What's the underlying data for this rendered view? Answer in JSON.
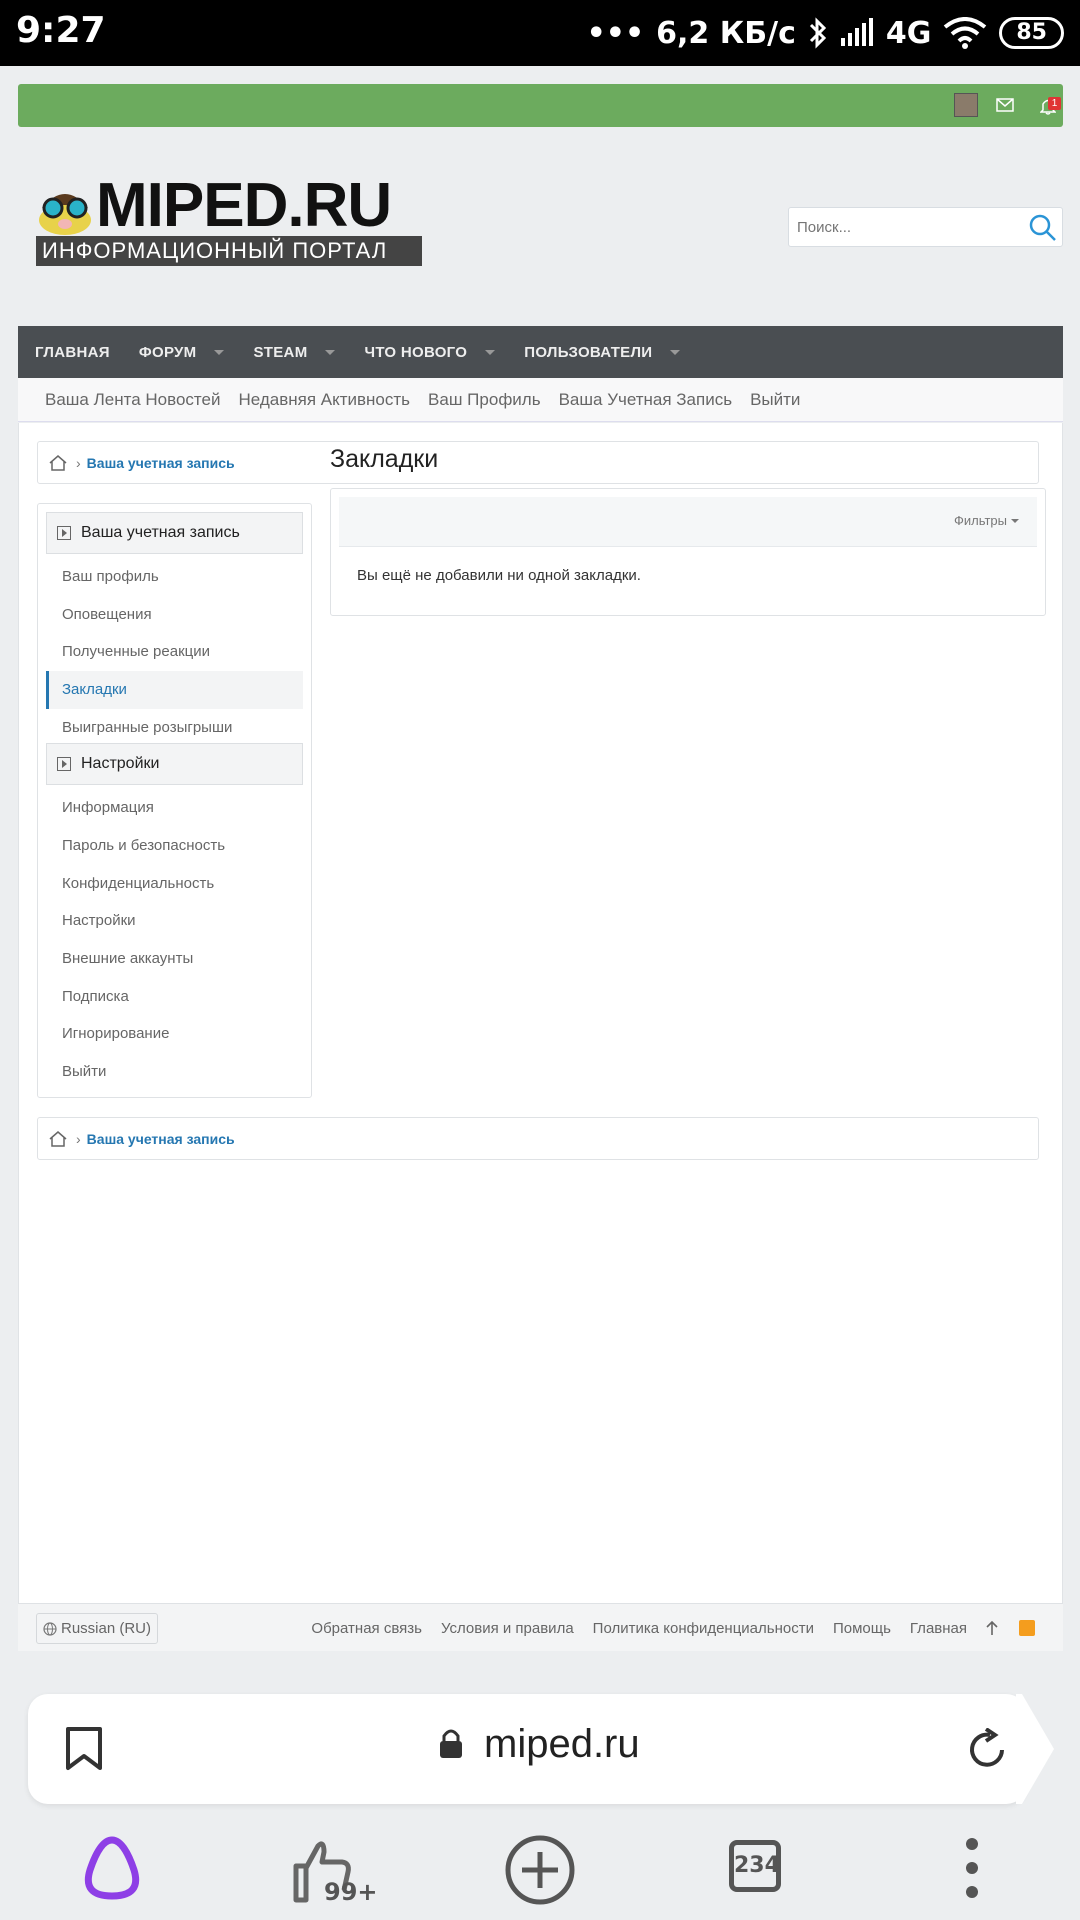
{
  "status_bar": {
    "time": "9:27",
    "network_speed": "6,2 КБ/с",
    "network_type": "4G",
    "battery": "85"
  },
  "topbar": {
    "notification_count": "1"
  },
  "header": {
    "logo_title": "MIPED.RU",
    "logo_subtitle": "ИНФОРМАЦИОННЫЙ ПОРТАЛ",
    "search_placeholder": "Поиск..."
  },
  "nav": {
    "items": [
      "ГЛАВНАЯ",
      "ФОРУМ",
      "STEAM",
      "ЧТО НОВОГО",
      "ПОЛЬЗОВАТЕЛИ"
    ]
  },
  "subnav": {
    "items": [
      "Ваша Лента Новостей",
      "Недавняя Активность",
      "Ваш Профиль",
      "Ваша Учетная Запись",
      "Выйти"
    ]
  },
  "breadcrumb": {
    "link": "Ваша учетная запись"
  },
  "sidebar": {
    "section1_title": "Ваша учетная запись",
    "section1_items": [
      "Ваш профиль",
      "Оповещения",
      "Полученные реакции",
      "Закладки",
      "Выигранные розыгрыши"
    ],
    "section2_title": "Настройки",
    "section2_items": [
      "Информация",
      "Пароль и безопасность",
      "Конфиденциальность",
      "Настройки",
      "Внешние аккаунты",
      "Подписка",
      "Игнорирование",
      "Выйти"
    ]
  },
  "main": {
    "title": "Закладки",
    "filters_label": "Фильтры",
    "empty_message": "Вы ещё не добавили ни одной закладки."
  },
  "footer": {
    "language": "Russian (RU)",
    "links": [
      "Обратная связь",
      "Условия и правила",
      "Политика конфиденциальности",
      "Помощь",
      "Главная"
    ]
  },
  "browser": {
    "url": "miped.ru",
    "likes_badge": "99+",
    "tabs_count": "234"
  },
  "colors": {
    "topbar": "#6cab5e",
    "nav": "#4a4e52",
    "link": "#2577b1",
    "alice": "#8e3fe6"
  }
}
